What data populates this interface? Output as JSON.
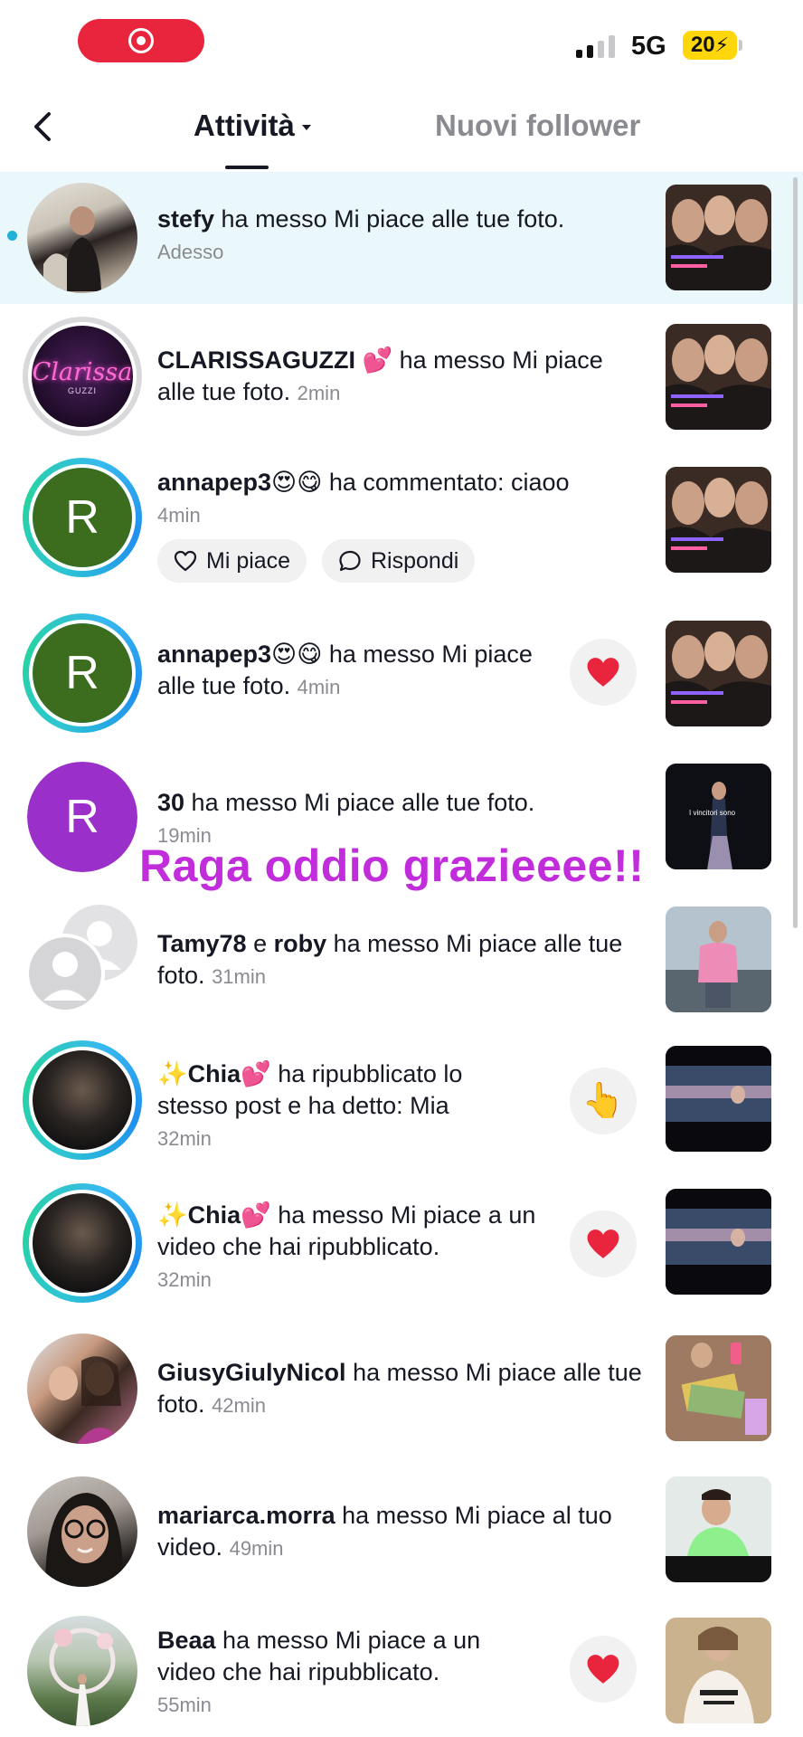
{
  "status_bar": {
    "network": "5G",
    "battery": "20",
    "colors": {
      "record_pill": "#e8253c",
      "battery": "#ffd60a"
    }
  },
  "header": {
    "tabs": [
      {
        "label": "Attività",
        "active": true
      },
      {
        "label": "Nuovi follower",
        "active": false
      }
    ]
  },
  "overlay_text": "Raga oddio grazieeee!!",
  "colors": {
    "accent_unread": "#20b2d6",
    "overlay": "#c22ddb",
    "heart": "#fe2c55"
  },
  "notifications": [
    {
      "user": "stefy",
      "action": " ha messo Mi piace alle tue foto.",
      "time": "Adesso",
      "unread": true,
      "avatar": "photo-girl-sofa"
    },
    {
      "user": "CLARISSAGUZZI",
      "user_emoji": "💕",
      "action": " ha messo Mi piace alle tue foto.",
      "time": "2min",
      "avatar": "clarissa-logo",
      "avatar_text": "Clarissa",
      "avatar_subtext": "GUZZI"
    },
    {
      "user": "annapep3",
      "user_emoji": "😍😋",
      "action": " ha commentato: ciaoo",
      "time": "4min",
      "avatar": "letter",
      "avatar_letter": "R",
      "buttons": {
        "like": "Mi piace",
        "reply": "Rispondi"
      }
    },
    {
      "user": "annapep3",
      "user_emoji": "😍😋",
      "action": " ha messo Mi piace alle tue foto.",
      "time": "4min",
      "avatar": "letter",
      "avatar_letter": "R",
      "like_button": "heart"
    },
    {
      "user": "30",
      "action": " ha messo Mi piace alle tue foto.",
      "time": "19min",
      "avatar": "letter",
      "avatar_letter": "R",
      "thumb_text": "I vincitori sono"
    },
    {
      "user": "Tamy78",
      "conj": " e ",
      "user2": "roby",
      "action": " ha messo Mi piace alle tue foto.",
      "time": "31min",
      "avatar": "default-pair"
    },
    {
      "user_prefix": "✨",
      "user": "Chia",
      "user_emoji": "💕",
      "action": " ha ripubblicato lo stesso post e ha detto: Mia",
      "time": "32min",
      "avatar": "photo-boy",
      "like_button": "hand"
    },
    {
      "user_prefix": "✨",
      "user": "Chia",
      "user_emoji": "💕",
      "action": " ha messo Mi piace a un video che hai ripubblicato.",
      "time": "32min",
      "avatar": "photo-boy",
      "like_button": "heart"
    },
    {
      "user": "GiusyGiulyNicol",
      "action": " ha messo Mi piace alle tue foto.",
      "time": "42min",
      "avatar": "photo-two-women"
    },
    {
      "user": "mariarca.morra",
      "action": " ha messo Mi piace al tuo video.",
      "time": "49min",
      "avatar": "photo-glasses"
    },
    {
      "user": "Beaa",
      "action": " ha messo Mi piace a un video che hai ripubblicato.",
      "time": "55min",
      "avatar": "photo-garden",
      "like_button": "heart"
    }
  ]
}
